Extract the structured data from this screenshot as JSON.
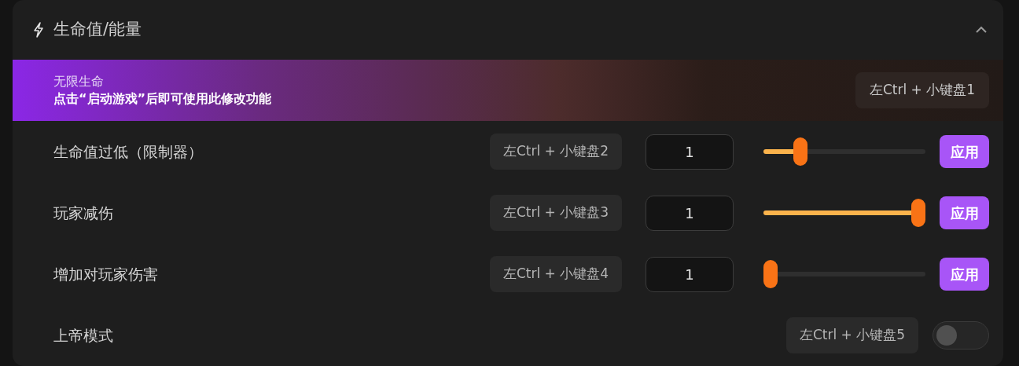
{
  "section": {
    "title": "生命值/能量",
    "expanded": true
  },
  "items": [
    {
      "kind": "notice",
      "label": "无限生命",
      "hint": "点击“启动游戏”后即可使用此修改功能",
      "hotkey": "左Ctrl + 小键盘1"
    },
    {
      "kind": "slider",
      "label": "生命值过低（限制器）",
      "hotkey": "左Ctrl + 小键盘2",
      "value": "1",
      "level": 0.2,
      "button": "应用"
    },
    {
      "kind": "slider",
      "label": "玩家减伤",
      "hotkey": "左Ctrl + 小键盘3",
      "value": "1",
      "level": 1,
      "button": "应用"
    },
    {
      "kind": "slider",
      "label": "增加对玩家伤害",
      "hotkey": "左Ctrl + 小键盘4",
      "value": "1",
      "level": 0,
      "button": "应用"
    },
    {
      "kind": "toggle",
      "label": "上帝模式",
      "hotkey": "左Ctrl + 小键盘5",
      "on": false
    }
  ]
}
